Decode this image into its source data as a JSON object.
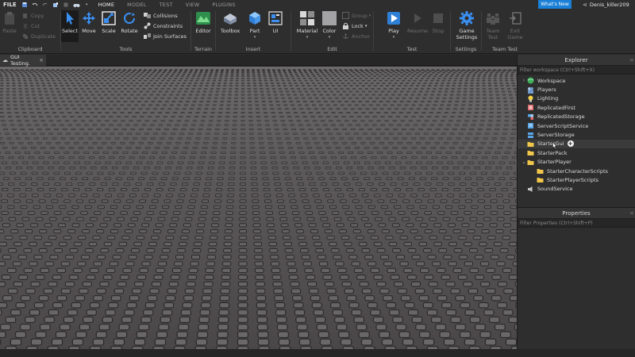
{
  "menubar": {
    "file_label": "FILE",
    "tabs": [
      "HOME",
      "MODEL",
      "TEST",
      "VIEW",
      "PLUGINS"
    ],
    "whats_new": "What's New",
    "username": "Denis_killer209"
  },
  "ribbon": {
    "clipboard": {
      "paste": "Paste",
      "copy": "Copy",
      "cut": "Cut",
      "duplicate": "Duplicate",
      "label": "Clipboard"
    },
    "tools": {
      "select": "Select",
      "move": "Move",
      "scale": "Scale",
      "rotate": "Rotate",
      "collisions": "Collisions",
      "constraints": "Constraints",
      "join_surfaces": "Join Surfaces",
      "label": "Tools"
    },
    "terrain": {
      "editor": "Editor",
      "label": "Terrain"
    },
    "insert": {
      "toolbox": "Toolbox",
      "part": "Part",
      "ui": "UI",
      "label": "Insert"
    },
    "edit": {
      "material": "Material",
      "color": "Color",
      "group": "Group",
      "lock": "Lock",
      "anchor": "Anchor",
      "label": "Edit"
    },
    "test": {
      "play": "Play",
      "resume": "Resume",
      "stop": "Stop",
      "label": "Test"
    },
    "settings": {
      "game_settings_line1": "Game",
      "game_settings_line2": "Settings",
      "label": "Settings"
    },
    "team_test": {
      "team_test_line1": "Team",
      "team_test_line2": "Test",
      "exit_game_line1": "Exit",
      "exit_game_line2": "Game",
      "label": "Team Test"
    }
  },
  "document_tab": {
    "title": "GUI Testing."
  },
  "explorer": {
    "title": "Explorer",
    "filter_placeholder": "Filter workspace (Ctrl+Shift+X)",
    "items": [
      {
        "label": "Workspace",
        "icon": "globe-icon"
      },
      {
        "label": "Players",
        "icon": "players-icon"
      },
      {
        "label": "Lighting",
        "icon": "lightbulb-icon"
      },
      {
        "label": "ReplicatedFirst",
        "icon": "replicated-icon"
      },
      {
        "label": "ReplicatedStorage",
        "icon": "replicated-storage-icon"
      },
      {
        "label": "ServerScriptService",
        "icon": "server-script-icon"
      },
      {
        "label": "ServerStorage",
        "icon": "server-storage-icon"
      },
      {
        "label": "StarterGui",
        "icon": "folder-icon"
      },
      {
        "label": "StarterPack",
        "icon": "folder-icon"
      },
      {
        "label": "StarterPlayer",
        "icon": "folder-icon"
      },
      {
        "label": "StarterCharacterScripts",
        "icon": "folder-icon"
      },
      {
        "label": "StarterPlayerScripts",
        "icon": "folder-icon"
      },
      {
        "label": "SoundService",
        "icon": "sound-icon"
      }
    ]
  },
  "properties": {
    "title": "Properties",
    "filter_placeholder": "Filter Properties (Ctrl+Shift+P)"
  },
  "colors": {
    "accent": "#1a7fd6",
    "baseplate": "#5a5758"
  }
}
